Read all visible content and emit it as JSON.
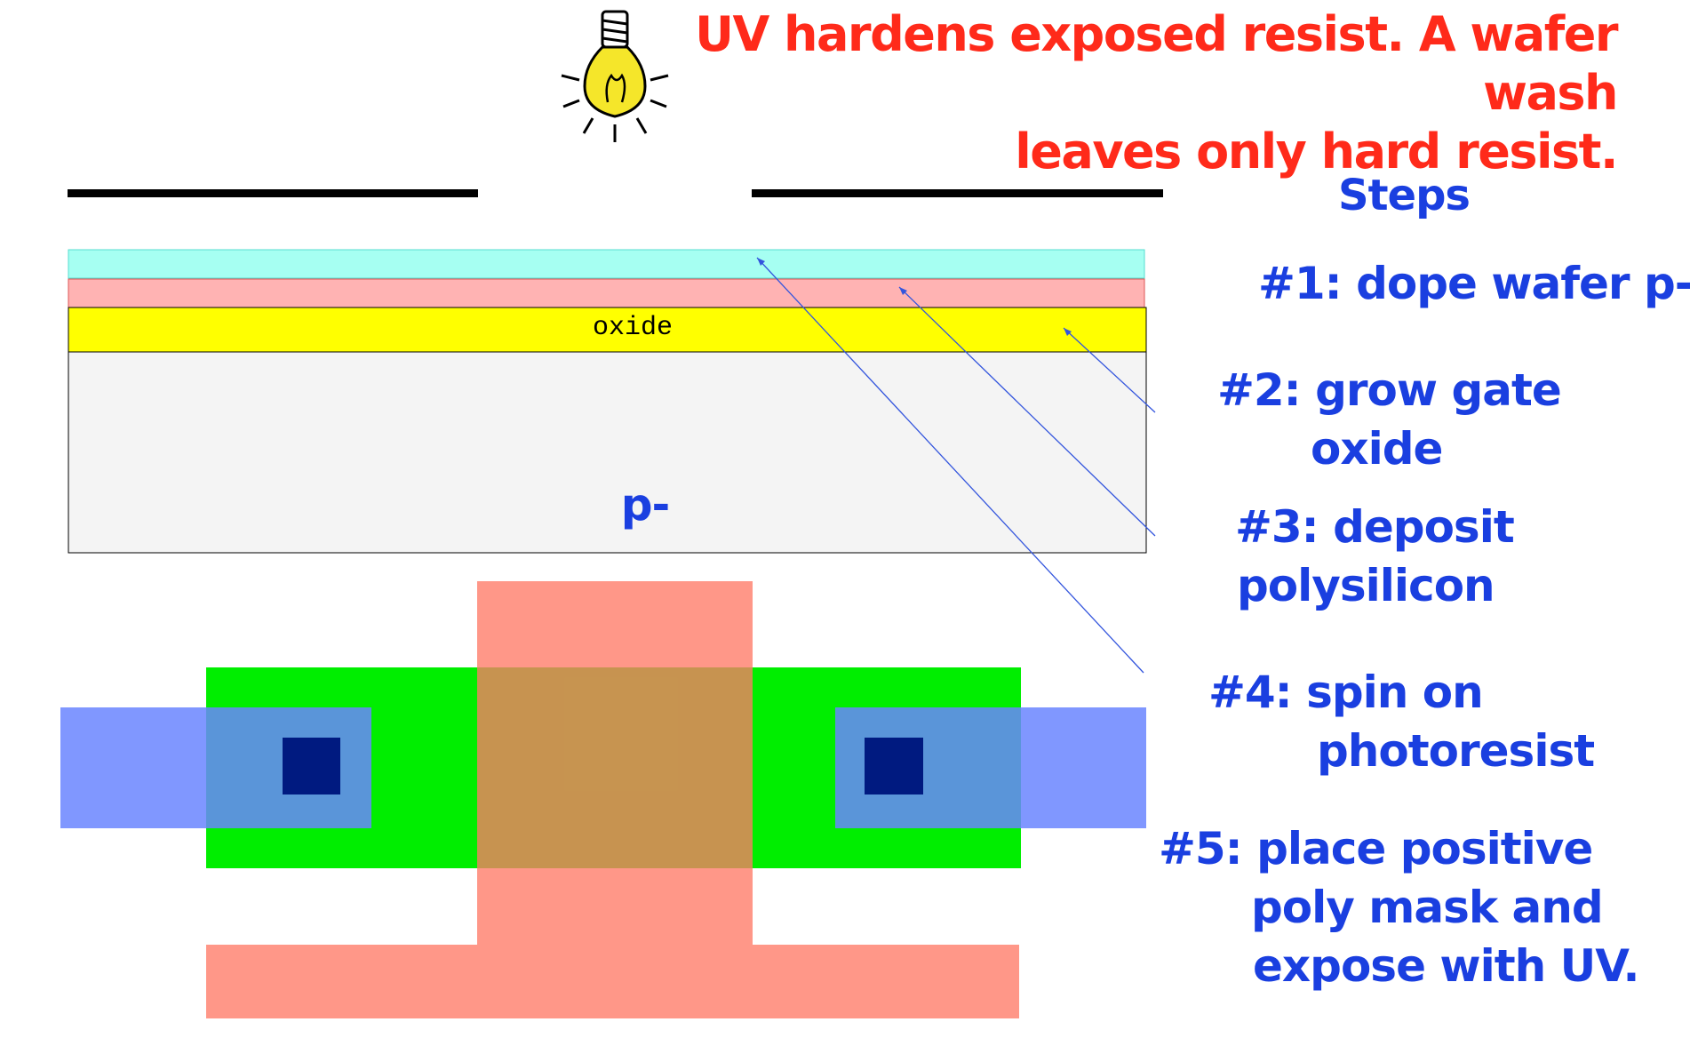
{
  "headline": {
    "line1": "UV hardens exposed resist. A wafer wash",
    "line2": "leaves only hard resist."
  },
  "steps": {
    "title": "Steps",
    "items": [
      {
        "lines": [
          "#1: dope wafer p-"
        ]
      },
      {
        "lines": [
          "#2: grow gate",
          "oxide"
        ]
      },
      {
        "lines": [
          "#3: deposit",
          "polysilicon"
        ]
      },
      {
        "lines": [
          "#4: spin on",
          "photoresist"
        ]
      },
      {
        "lines": [
          "#5: place positive",
          "poly mask and",
          "expose with UV."
        ]
      }
    ]
  },
  "cross_section": {
    "oxide_label": "oxide",
    "substrate_label": "p-"
  },
  "colors": {
    "headline": "#ff2a1a",
    "steps": "#1a3fe0",
    "photoresist": "#a6fff2",
    "polysilicon": "#ffb3b3",
    "oxide": "#ffff00",
    "substrate": "#f4f4f4",
    "diffusion": "#00ee00",
    "poly_layout": "#ff9380",
    "metal": "#8096ff",
    "contact": "#001a80",
    "bulb": "#f5e62a"
  },
  "icons": [
    "lightbulb-icon"
  ]
}
